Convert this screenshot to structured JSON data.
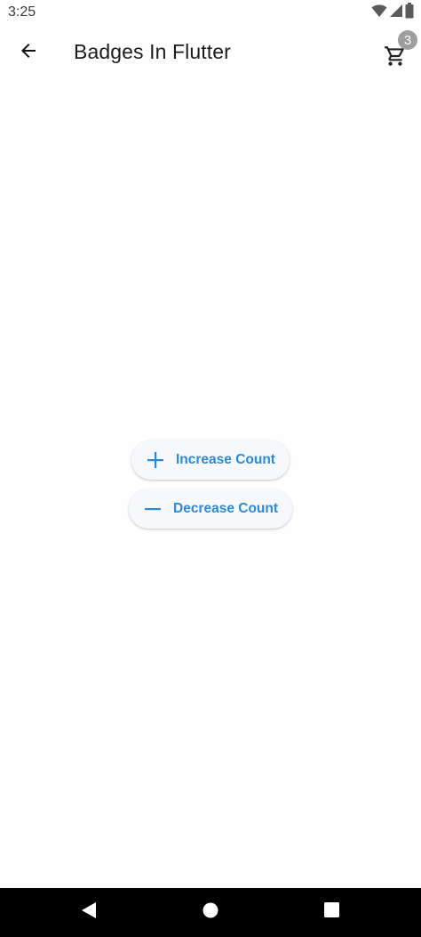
{
  "status_bar": {
    "time": "3:25",
    "icons": [
      "wifi-icon",
      "signal-icon",
      "battery-icon"
    ]
  },
  "app_bar": {
    "title": "Badges In Flutter",
    "back_icon": "arrow-back-icon",
    "cart_icon": "shopping-cart-icon",
    "cart_badge_count": "3"
  },
  "buttons": {
    "increase": {
      "label": "Increase Count",
      "icon": "plus-icon"
    },
    "decrease": {
      "label": "Decrease Count",
      "icon": "minus-icon"
    }
  },
  "nav_bar": {
    "items": [
      "nav-back-icon",
      "nav-home-icon",
      "nav-recents-icon"
    ]
  },
  "colors": {
    "accent": "#2b8ad8",
    "badge": "#9e9e9e",
    "button_bg": "#f6f8fb",
    "nav_bar": "#000000"
  }
}
